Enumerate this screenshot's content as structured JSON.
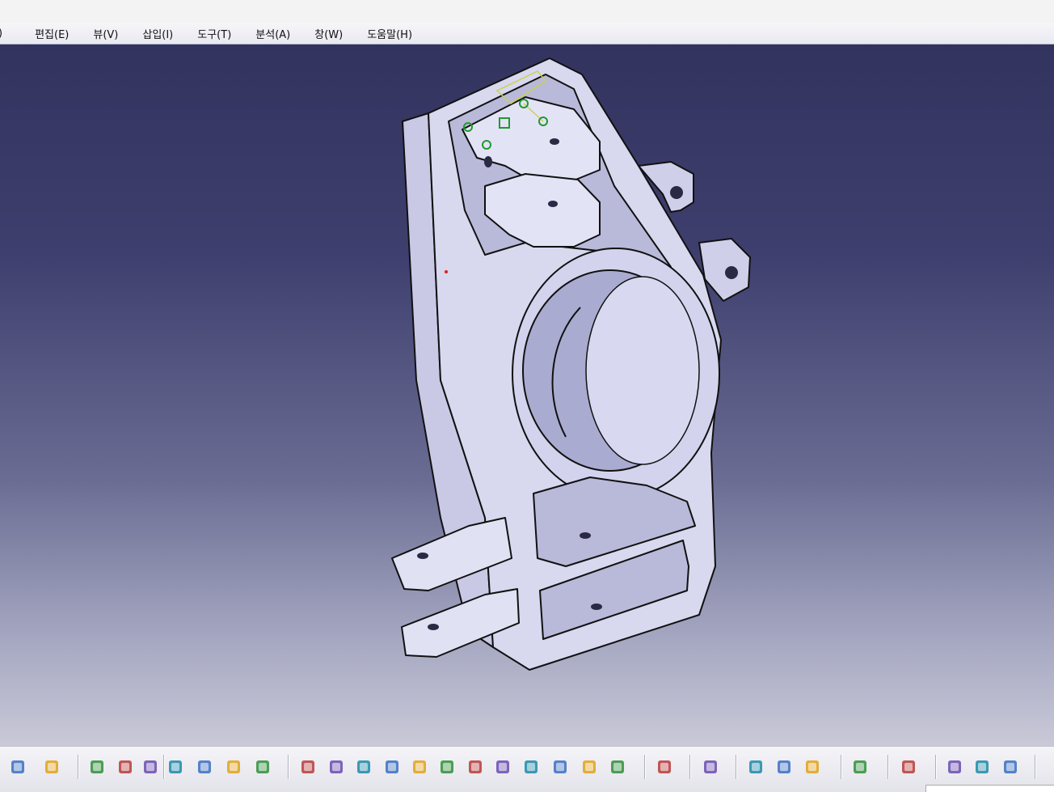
{
  "menu": {
    "partial_left": ")",
    "items": [
      "편집(E)",
      "뷰(V)",
      "삽입(I)",
      "도구(T)",
      "분석(A)",
      "창(W)",
      "도움말(H)"
    ]
  },
  "viewport": {
    "background_top": "#33335f",
    "background_bottom": "#c9c9d8",
    "part_color": "#d6d6ee",
    "part_shade": "#b7b8d8",
    "edge_color": "#111111",
    "sketch_color": "#c9d24a",
    "constraint_color": "#1f9a2d"
  },
  "toolbar": {
    "buttons": [
      "redo-icon",
      "whats-this-icon",
      "formula-icon",
      "comment-icon",
      "lock-icon",
      "table-icon",
      "product-structure-icon",
      "catalog-icon",
      "measure-list-icon",
      "fly-mode-icon",
      "fit-all-icon",
      "pan-icon",
      "rotate-icon",
      "zoom-in-icon",
      "zoom-out-icon",
      "normal-view-icon",
      "multi-view-icon",
      "iso-view-icon",
      "shading-icon",
      "hide-show-icon",
      "swap-space-icon",
      "capture-icon",
      "print-icon",
      "measure-between-icon",
      "measure-item-icon",
      "mass-icon",
      "update-icon",
      "sketch-icon",
      "apply-material-icon",
      "render-icon",
      "color-icon"
    ]
  }
}
